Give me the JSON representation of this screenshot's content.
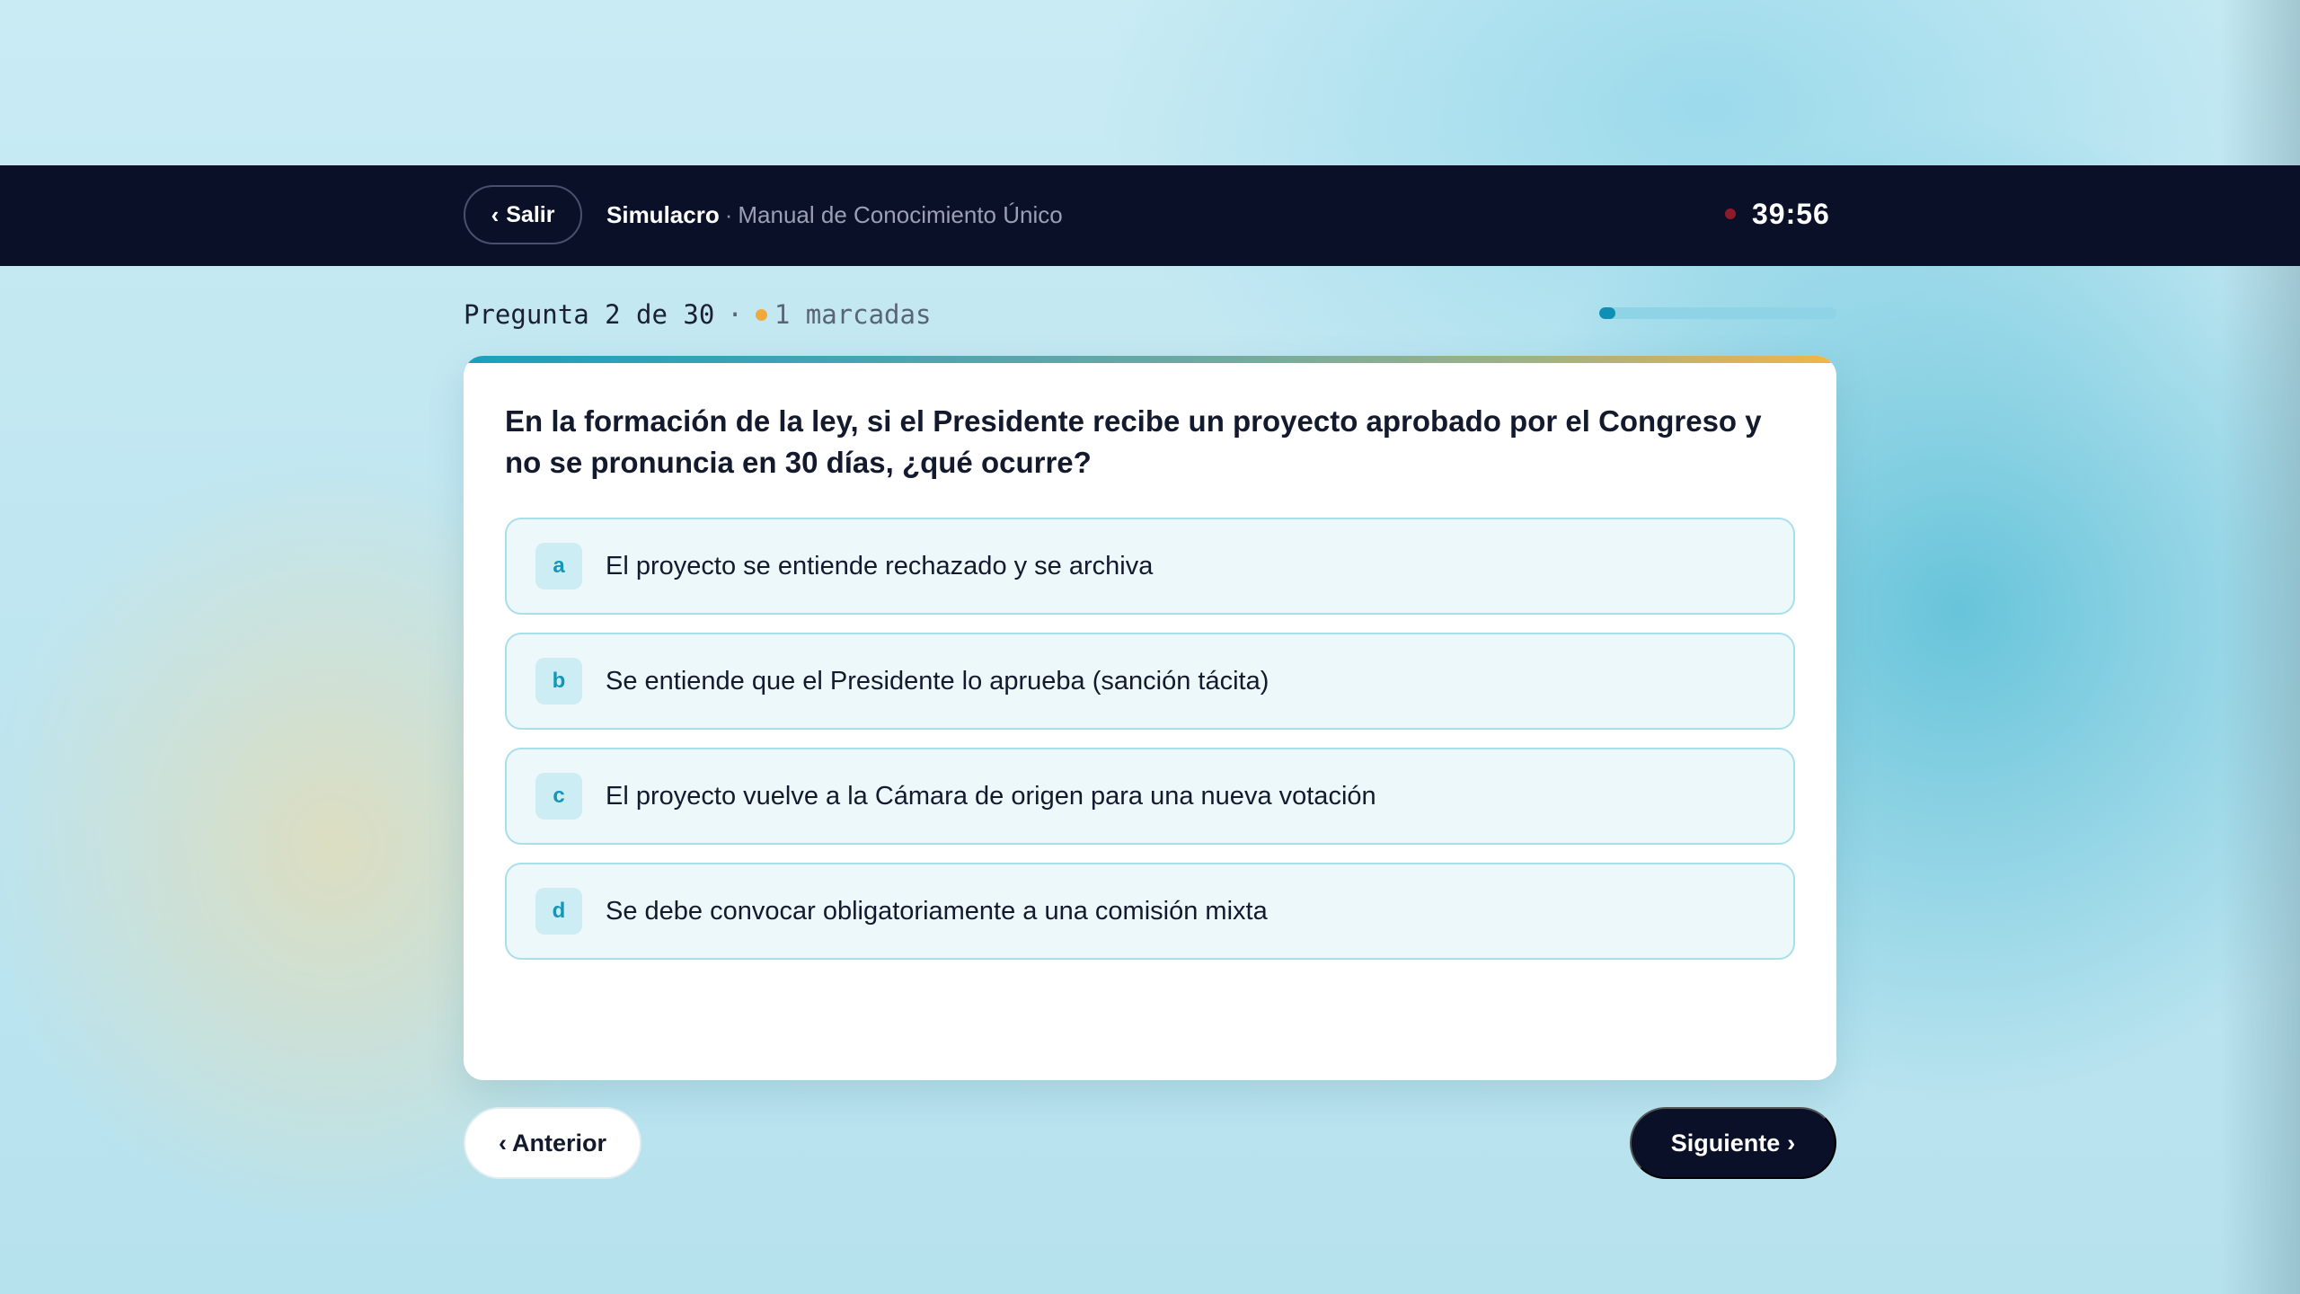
{
  "header": {
    "exit_label": "Salir",
    "exit_chevron": "‹",
    "mode": "Simulacro",
    "separator": "·",
    "manual_title": "Manual de Conocimiento Único",
    "timer": "39:56"
  },
  "status": {
    "question_counter": "Pregunta 2 de 30",
    "separator": "·",
    "marked_count": "1 marcadas",
    "progress_fraction": 0.0667
  },
  "question": {
    "text": "En la formación de la ley, si el Presidente recibe un proyecto aprobado por el Congreso y no se pronuncia en 30 días, ¿qué ocurre?",
    "options": [
      {
        "letter": "a",
        "text": "El proyecto se entiende rechazado y se archiva"
      },
      {
        "letter": "b",
        "text": "Se entiende que el Presidente lo aprueba (sanción tácita)"
      },
      {
        "letter": "c",
        "text": "El proyecto vuelve a la Cámara de origen para una nueva votación"
      },
      {
        "letter": "d",
        "text": "Se debe convocar obligatoriamente a una comisión mixta"
      }
    ]
  },
  "navigation": {
    "prev_label": "Anterior",
    "prev_chevron": "‹",
    "next_label": "Siguiente",
    "next_chevron": "›"
  },
  "colors": {
    "topbar": "#0b1029",
    "accent": "#1496b8",
    "marked_dot": "#f2a93b",
    "timer_dot": "#8e1a2a"
  }
}
